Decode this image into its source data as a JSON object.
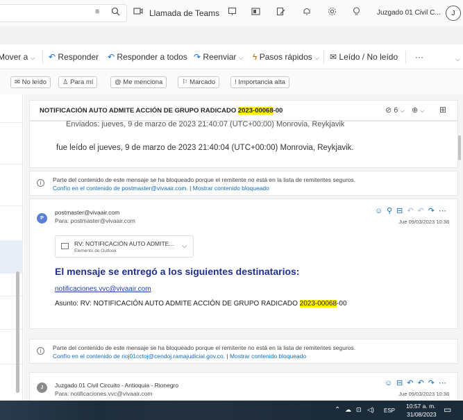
{
  "topbar": {
    "filter_icon": "filter-icon",
    "search_icon": "search-icon",
    "teams_icon": "video-call-icon",
    "teams_label": "Llamada de Teams",
    "icons": [
      "present-icon",
      "onenote-icon",
      "edit-icon",
      "bell-icon",
      "gear-icon",
      "lightbulb-icon"
    ],
    "account_label": "Juzgado 01 Civil C...",
    "avatar_initial": "J"
  },
  "ribbon": {
    "move_label": "Mover a",
    "reply_label": "Responder",
    "reply_all_label": "Responder a todos",
    "forward_label": "Reenviar",
    "quick_steps_label": "Pasos rápidos",
    "read_unread_label": "Leído / No leído",
    "more_label": "···"
  },
  "filters": {
    "items": [
      "No leído",
      "Para mí",
      "Me menciona",
      "Marcado",
      "Importancia alta"
    ]
  },
  "subject": {
    "prefix": "NOTIFICACIÓN AUTO ADMITE ACCIÓN DE GRUPO RADICADO ",
    "highlight": "2023-00068",
    "suffix": "-00",
    "attachment_count": "6",
    "zoom_icon": "zoom-icon",
    "popout_icon": "popout-icon"
  },
  "card1": {
    "line1": "Enviados: jueves, 9 de marzo de 2023 21:40:07 (UTC+00:00) Monrovia, Reykjavik",
    "line2": "fue leído el jueves, 9 de marzo de 2023 21:40:04 (UTC+00:00) Monrovia, Reykjavik."
  },
  "warning1": {
    "text": "Parte del contenido de este mensaje se ha bloqueado porque el remitente no está en la lista de remitentes seguros.",
    "trust_link": "Confío en el contenido de postmaster@vivaair.com.",
    "separator": "|",
    "show_link": "Mostrar contenido bloqueado"
  },
  "message1": {
    "avatar": "P",
    "avatar_color": "#5b7fd6",
    "from": "postmaster@vivaair.com",
    "to": "Para: postmaster@vivaair.com",
    "date": "Jue 09/03/2023 10:38",
    "attachment_name": "RV: NOTIFICACIÓN AUTO ADMITE...",
    "attachment_type": "Elemento de Outlook",
    "body_heading": "El mensaje se entregó a los siguientes destinatarios:",
    "recipient_link": "notificaciones.vvc@vivaair.com",
    "subject_prefix": "Asunto: RV: NOTIFICACIÓN AUTO ADMITE ACCIÓN DE GRUPO RADICADO ",
    "subject_highlight": "2023-00068",
    "subject_suffix": "-00"
  },
  "warning2": {
    "text": "Parte del contenido de este mensaje se ha bloqueado porque el remitente no está en la lista de remitentes seguros.",
    "trust_link": "Confío en el contenido de rioj01cctoj@cendoj.ramajudicial.gov.co.",
    "separator": "|",
    "show_link": "Mostrar contenido bloqueado"
  },
  "message2": {
    "avatar": "J",
    "avatar_color": "#8a8a8a",
    "from": "Juzgado 01 Civil Circuito - Antioquia - Rionegro",
    "to": "Para: notificaciones.vvc@vivaair.com",
    "date": "Jue 09/03/2023 10:38"
  },
  "taskbar": {
    "language": "ESP",
    "time": "10:57 a. m.",
    "date": "31/08/2023"
  }
}
